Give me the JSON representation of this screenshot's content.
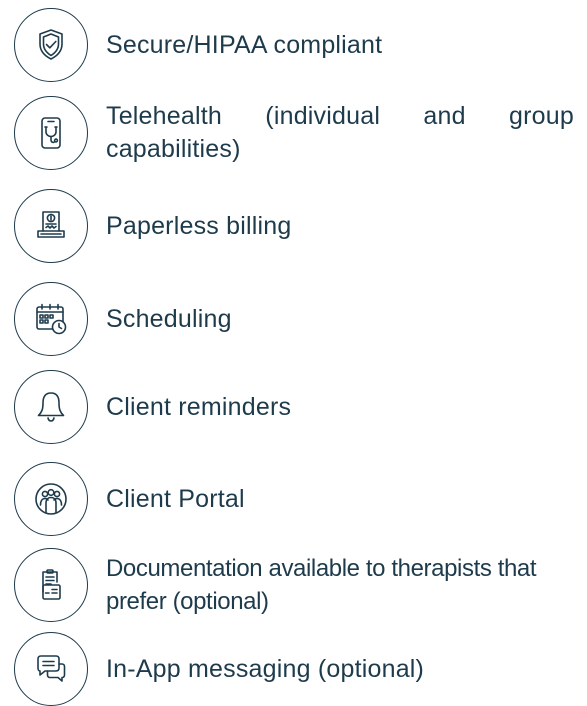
{
  "features": [
    {
      "label": "Secure/HIPAA compliant",
      "icon": "shield-check-icon"
    },
    {
      "label": "Telehealth (individual and group capabilities)",
      "icon": "mobile-stethoscope-icon"
    },
    {
      "label": "Paperless billing",
      "icon": "bill-receipt-icon"
    },
    {
      "label": "Scheduling",
      "icon": "calendar-clock-icon"
    },
    {
      "label": "Client reminders",
      "icon": "bell-icon"
    },
    {
      "label": "Client Portal",
      "icon": "user-group-icon"
    },
    {
      "label": "Documentation available to therapists that prefer (optional)",
      "icon": "clipboard-document-icon"
    },
    {
      "label": "In-App messaging (optional)",
      "icon": "chat-bubbles-icon"
    }
  ],
  "colors": {
    "text": "#1e3b4c",
    "icon_stroke": "#1e3b4c",
    "background": "#ffffff"
  }
}
